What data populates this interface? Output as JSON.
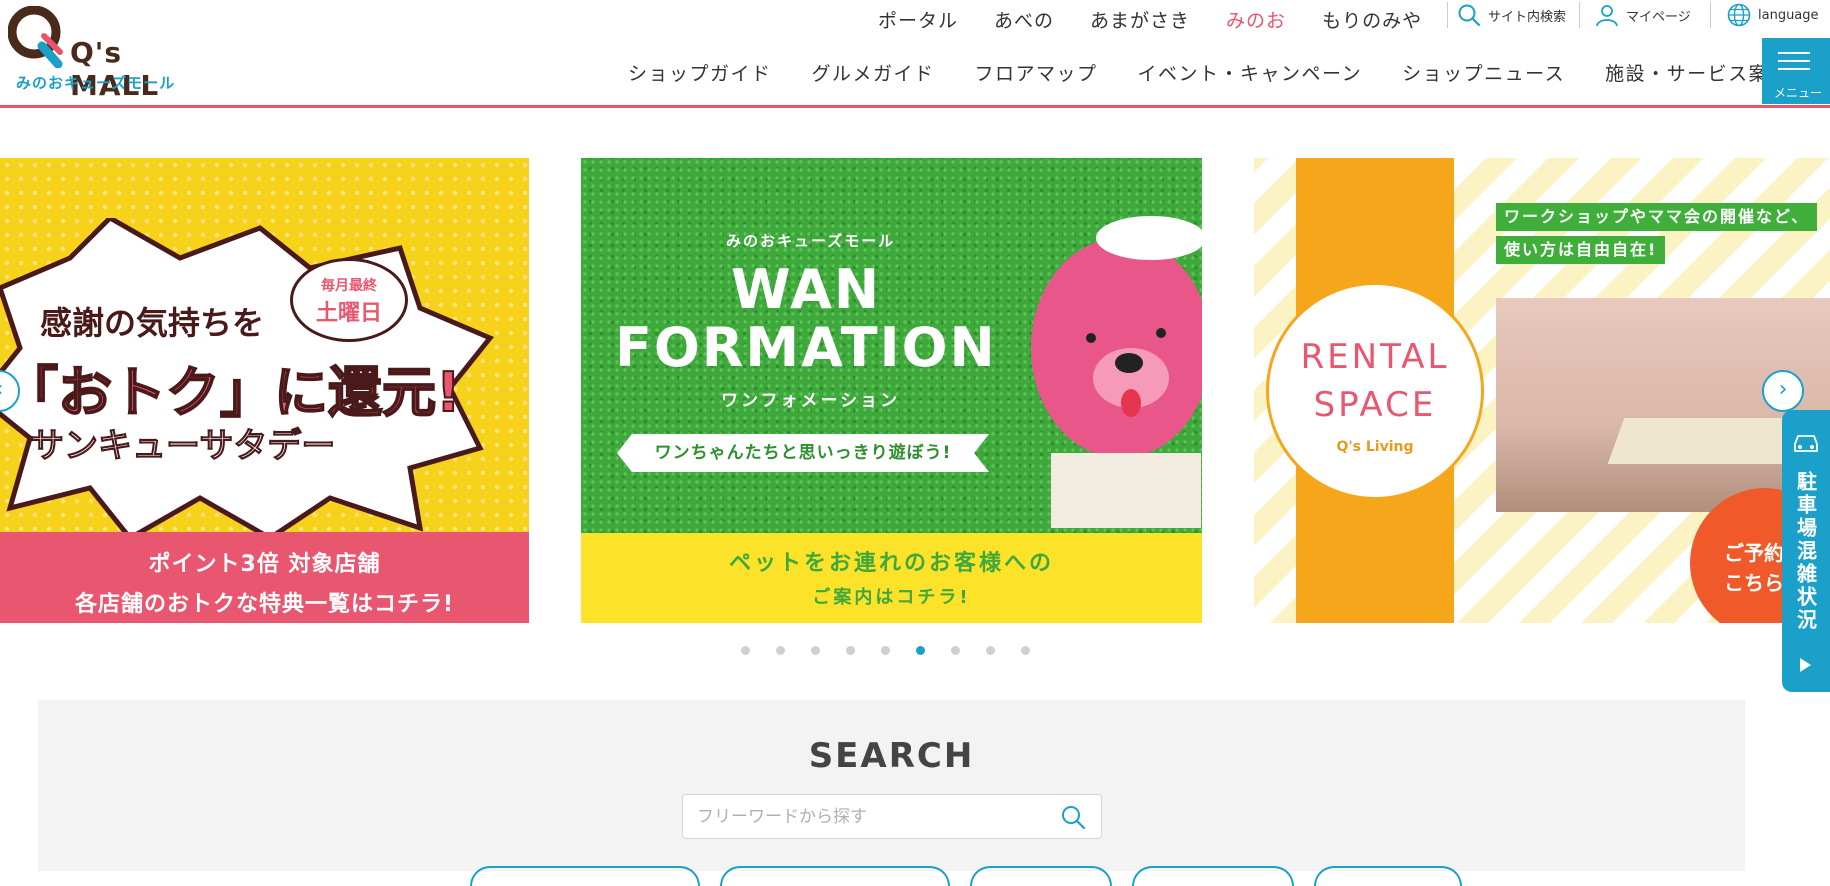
{
  "header": {
    "logo_mark": "Q's MALL",
    "logo_sub": "みのおキューズモール",
    "top_links": [
      "ポータル",
      "あべの",
      "あまがさき",
      "みのお",
      "もりのみや"
    ],
    "active_top_link": "みのお",
    "site_search": "サイト内検索",
    "mypage": "マイページ",
    "language": "language",
    "main_nav": [
      "ショップガイド",
      "グルメガイド",
      "フロアマップ",
      "イベント・キャンペーン",
      "ショップニュース",
      "施設・サービス案内"
    ],
    "menu_label": "メニュー"
  },
  "slides": {
    "s1": {
      "badge_line1": "毎月最終",
      "badge_line2": "土曜日",
      "line1": "感謝の気持ちを",
      "line2": "「おトク」に還元!",
      "line3": "サンキューサタデー",
      "bottom1": "ポイント3倍 対象店舗",
      "bottom2": "各店舗のおトクな特典一覧はコチラ!"
    },
    "s2": {
      "mini": "みのおキューズモール",
      "title1": "WAN",
      "title2": "FORMATION",
      "kana": "ワンフォメーション",
      "ribbon": "ワンちゃんたちと思いっきり遊ぼう!",
      "bottom1": "ペットをお連れのお客様への",
      "bottom2": "ご案内はコチラ!"
    },
    "s3": {
      "tag1": "ワークショップやママ会の開催など、",
      "tag2": "使い方は自由自在!",
      "rental": "RENTAL",
      "space": "SPACE",
      "brand": "Q's Living",
      "cta1": "ご予約",
      "cta2": "こちら"
    }
  },
  "carousel": {
    "prev": "‹",
    "next": "›",
    "dots": 9,
    "active_dot": 6
  },
  "parking": {
    "label": "駐車場混雑状況"
  },
  "search": {
    "title": "SEARCH",
    "placeholder": "フリーワードから探す"
  },
  "colors": {
    "accent_pink": "#e9546b",
    "accent_blue": "#1aa0c9"
  }
}
